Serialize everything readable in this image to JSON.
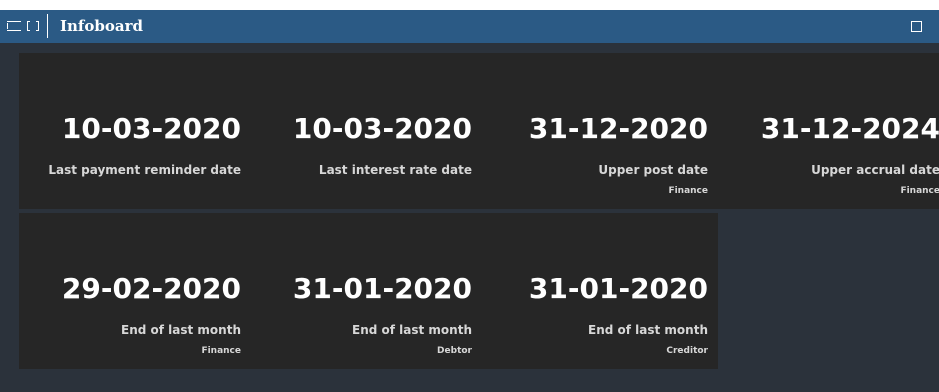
{
  "window": {
    "title": "Infoboard"
  },
  "icons": {
    "menu": "menu-icon",
    "expand": "expand-icon",
    "maximize": "maximize-icon"
  },
  "colors": {
    "titlebar": "#2b5a85",
    "background": "#2b323b",
    "tile": "#262626",
    "date_text": "#ffffff",
    "label_text": "#d7d7d7"
  },
  "tiles": [
    {
      "date": "10-03-2020",
      "label": "Last payment reminder date",
      "sub": ""
    },
    {
      "date": "10-03-2020",
      "label": "Last interest rate date",
      "sub": ""
    },
    {
      "date": "31-12-2020",
      "label": "Upper post date",
      "sub": "Finance"
    },
    {
      "date": "31-12-2024",
      "label": "Upper accrual date",
      "sub": "Finance"
    },
    {
      "date": "29-02-2020",
      "label": "End of last month",
      "sub": "Finance"
    },
    {
      "date": "31-01-2020",
      "label": "End of last month",
      "sub": "Debtor"
    },
    {
      "date": "31-01-2020",
      "label": "End of last month",
      "sub": "Creditor"
    }
  ]
}
